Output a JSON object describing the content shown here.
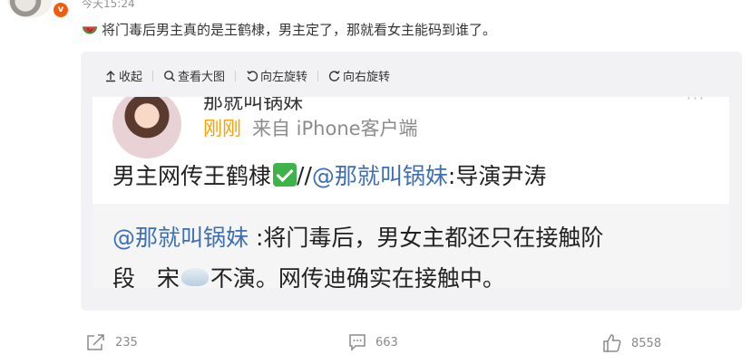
{
  "post": {
    "timestamp": "今天15:24",
    "text": "将门毒后男主真的是王鹤棣，男主定了，那就看女主能码到谁了。"
  },
  "media_toolbar": {
    "collapse": "收起",
    "view_large": "查看大图",
    "rotate_left": "向左旋转",
    "rotate_right": "向右旋转"
  },
  "embedded_post": {
    "author_cut": "那就叫锅妹",
    "time": "刚刚",
    "source": "来自 iPhone客户端",
    "line1_text": "男主网传王鹤棣",
    "line1_sep": "//",
    "line1_mention": "@那就叫锅妹",
    "line1_rest": ":导演尹涛",
    "quote_mention": "@那就叫锅妹",
    "quote_line1_rest": " :将门毒后，男女主都还只在接触阶",
    "quote_line2_a": "段   宋",
    "quote_line2_b": "不演。网传迪确实在接触中。"
  },
  "actions": {
    "share_count": "235",
    "comment_count": "663",
    "like_count": "8558"
  },
  "colors": {
    "accent_link": "#3f6fb3",
    "time_orange": "#f5a100",
    "vip_orange": "#f15b0e"
  }
}
